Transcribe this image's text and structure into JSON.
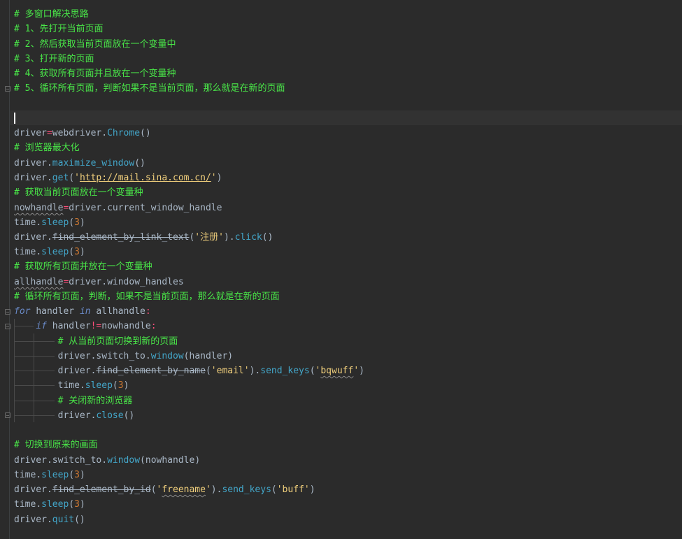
{
  "comments": {
    "header_title": "# 多窗口解决思路",
    "step1": "# 1、先打开当前页面",
    "step2": "# 2、然后获取当前页面放在一个变量中",
    "step3": "# 3、打开新的页面",
    "step4": "# 4、获取所有页面并且放在一个变量种",
    "step5": "# 5、循环所有页面，判断如果不是当前页面，那么就是在新的页面",
    "maximize": "# 浏览器最大化",
    "get_current": "# 获取当前页面放在一个变量种",
    "get_all": "# 获取所有页面并放在一个变量种",
    "loop": "# 循环所有页面，判断，如果不是当前页面，那么就是在新的页面",
    "switch_new": "# 从当前页面切换到新的页面",
    "close_new": "# 关闭新的浏览器",
    "switch_back": "# 切换到原来的画面"
  },
  "code": {
    "driver": "driver",
    "time": "time",
    "webdriver": "webdriver",
    "chrome": "Chrome",
    "maximize_window": "maximize_window",
    "get": "get",
    "url": "http://mail.sina.com.cn/",
    "nowhandle": "nowhandle",
    "current_window_handle": "current_window_handle",
    "sleep": "sleep",
    "sleep_arg": "3",
    "find_link_text": "find_element_by_link_text",
    "register_str": "'注册'",
    "click": "click",
    "allhandle": "allhandle",
    "window_handles": "window_handles",
    "kw_for": "for",
    "kw_in": "in",
    "kw_if": "if",
    "handler": "handler",
    "switch_to": "switch_to",
    "window": "window",
    "find_by_name": "find_element_by_name",
    "email_str": "'email'",
    "send_keys": "send_keys",
    "bqwuff_str_prefix": "'",
    "bqwuff_word": "bqwuff",
    "bqwuff_str_suffix": "'",
    "close": "close",
    "find_by_id": "find_element_by_id",
    "freename_str_prefix": "'",
    "freename_word": "freename",
    "freename_str_suffix": "'",
    "buff_str": "'buff'",
    "quit": "quit"
  },
  "colors": {
    "background": "#2b2b2b",
    "comment": "#49e648",
    "operator": "#ff4f7b",
    "keyword": "#6a8ac7",
    "function": "#43a6c9",
    "number": "#cc7832",
    "string": "#f0cf7c",
    "default_text": "#a9b7c6"
  }
}
